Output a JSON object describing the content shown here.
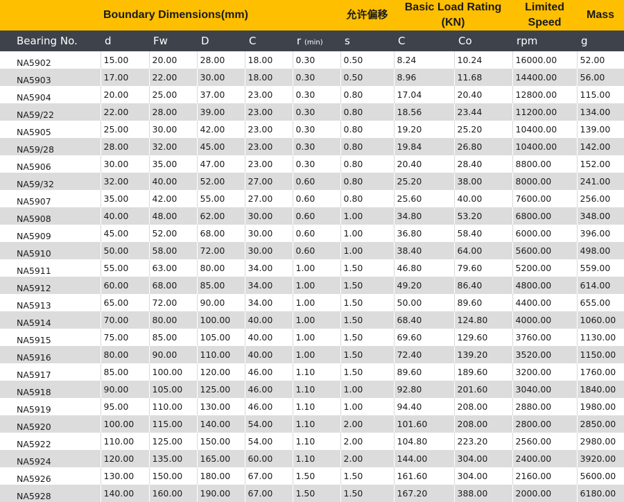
{
  "header": {
    "boundary": "Boundary Dimensions(mm)",
    "allowed_offset": "允许偏移",
    "basic_load_rating": "Basic Load Rating (KN)",
    "limited_speed": "Limited Speed",
    "mass": "Mass"
  },
  "columns": [
    {
      "label": "Bearing No.",
      "sub": ""
    },
    {
      "label": "d",
      "sub": ""
    },
    {
      "label": "Fw",
      "sub": ""
    },
    {
      "label": "D",
      "sub": ""
    },
    {
      "label": "C",
      "sub": ""
    },
    {
      "label": "r",
      "sub": "(min)"
    },
    {
      "label": "s",
      "sub": ""
    },
    {
      "label": "C",
      "sub": ""
    },
    {
      "label": "Co",
      "sub": ""
    },
    {
      "label": "rpm",
      "sub": ""
    },
    {
      "label": "g",
      "sub": ""
    }
  ],
  "rows": [
    [
      "NA5902",
      "15.00",
      "20.00",
      "28.00",
      "18.00",
      "0.30",
      "0.50",
      "8.24",
      "10.24",
      "16000.00",
      "52.00"
    ],
    [
      "NA5903",
      "17.00",
      "22.00",
      "30.00",
      "18.00",
      "0.30",
      "0.50",
      "8.96",
      "11.68",
      "14400.00",
      "56.00"
    ],
    [
      "NA5904",
      "20.00",
      "25.00",
      "37.00",
      "23.00",
      "0.30",
      "0.80",
      "17.04",
      "20.40",
      "12800.00",
      "115.00"
    ],
    [
      "NA59/22",
      "22.00",
      "28.00",
      "39.00",
      "23.00",
      "0.30",
      "0.80",
      "18.56",
      "23.44",
      "11200.00",
      "134.00"
    ],
    [
      "NA5905",
      "25.00",
      "30.00",
      "42.00",
      "23.00",
      "0.30",
      "0.80",
      "19.20",
      "25.20",
      "10400.00",
      "139.00"
    ],
    [
      "NA59/28",
      "28.00",
      "32.00",
      "45.00",
      "23.00",
      "0.30",
      "0.80",
      "19.84",
      "26.80",
      "10400.00",
      "142.00"
    ],
    [
      "NA5906",
      "30.00",
      "35.00",
      "47.00",
      "23.00",
      "0.30",
      "0.80",
      "20.40",
      "28.40",
      "8800.00",
      "152.00"
    ],
    [
      "NA59/32",
      "32.00",
      "40.00",
      "52.00",
      "27.00",
      "0.60",
      "0.80",
      "25.20",
      "38.00",
      "8000.00",
      "241.00"
    ],
    [
      "NA5907",
      "35.00",
      "42.00",
      "55.00",
      "27.00",
      "0.60",
      "0.80",
      "25.60",
      "40.00",
      "7600.00",
      "256.00"
    ],
    [
      "NA5908",
      "40.00",
      "48.00",
      "62.00",
      "30.00",
      "0.60",
      "1.00",
      "34.80",
      "53.20",
      "6800.00",
      "348.00"
    ],
    [
      "NA5909",
      "45.00",
      "52.00",
      "68.00",
      "30.00",
      "0.60",
      "1.00",
      "36.80",
      "58.40",
      "6000.00",
      "396.00"
    ],
    [
      "NA5910",
      "50.00",
      "58.00",
      "72.00",
      "30.00",
      "0.60",
      "1.00",
      "38.40",
      "64.00",
      "5600.00",
      "498.00"
    ],
    [
      "NA5911",
      "55.00",
      "63.00",
      "80.00",
      "34.00",
      "1.00",
      "1.50",
      "46.80",
      "79.60",
      "5200.00",
      "559.00"
    ],
    [
      "NA5912",
      "60.00",
      "68.00",
      "85.00",
      "34.00",
      "1.00",
      "1.50",
      "49.20",
      "86.40",
      "4800.00",
      "614.00"
    ],
    [
      "NA5913",
      "65.00",
      "72.00",
      "90.00",
      "34.00",
      "1.00",
      "1.50",
      "50.00",
      "89.60",
      "4400.00",
      "655.00"
    ],
    [
      "NA5914",
      "70.00",
      "80.00",
      "100.00",
      "40.00",
      "1.00",
      "1.50",
      "68.40",
      "124.80",
      "4000.00",
      "1060.00"
    ],
    [
      "NA5915",
      "75.00",
      "85.00",
      "105.00",
      "40.00",
      "1.00",
      "1.50",
      "69.60",
      "129.60",
      "3760.00",
      "1130.00"
    ],
    [
      "NA5916",
      "80.00",
      "90.00",
      "110.00",
      "40.00",
      "1.00",
      "1.50",
      "72.40",
      "139.20",
      "3520.00",
      "1150.00"
    ],
    [
      "NA5917",
      "85.00",
      "100.00",
      "120.00",
      "46.00",
      "1.10",
      "1.50",
      "89.60",
      "189.60",
      "3200.00",
      "1760.00"
    ],
    [
      "NA5918",
      "90.00",
      "105.00",
      "125.00",
      "46.00",
      "1.10",
      "1.00",
      "92.80",
      "201.60",
      "3040.00",
      "1840.00"
    ],
    [
      "NA5919",
      "95.00",
      "110.00",
      "130.00",
      "46.00",
      "1.10",
      "1.00",
      "94.40",
      "208.00",
      "2880.00",
      "1980.00"
    ],
    [
      "NA5920",
      "100.00",
      "115.00",
      "140.00",
      "54.00",
      "1.10",
      "2.00",
      "101.60",
      "208.00",
      "2800.00",
      "2850.00"
    ],
    [
      "NA5922",
      "110.00",
      "125.00",
      "150.00",
      "54.00",
      "1.10",
      "2.00",
      "104.80",
      "223.20",
      "2560.00",
      "2980.00"
    ],
    [
      "NA5924",
      "120.00",
      "135.00",
      "165.00",
      "60.00",
      "1.10",
      "2.00",
      "144.00",
      "304.00",
      "2400.00",
      "3920.00"
    ],
    [
      "NA5926",
      "130.00",
      "150.00",
      "180.00",
      "67.00",
      "1.50",
      "1.50",
      "161.60",
      "304.00",
      "2160.00",
      "5600.00"
    ],
    [
      "NA5928",
      "140.00",
      "160.00",
      "190.00",
      "67.00",
      "1.50",
      "1.50",
      "167.20",
      "388.00",
      "2000.00",
      "6180.00"
    ]
  ]
}
